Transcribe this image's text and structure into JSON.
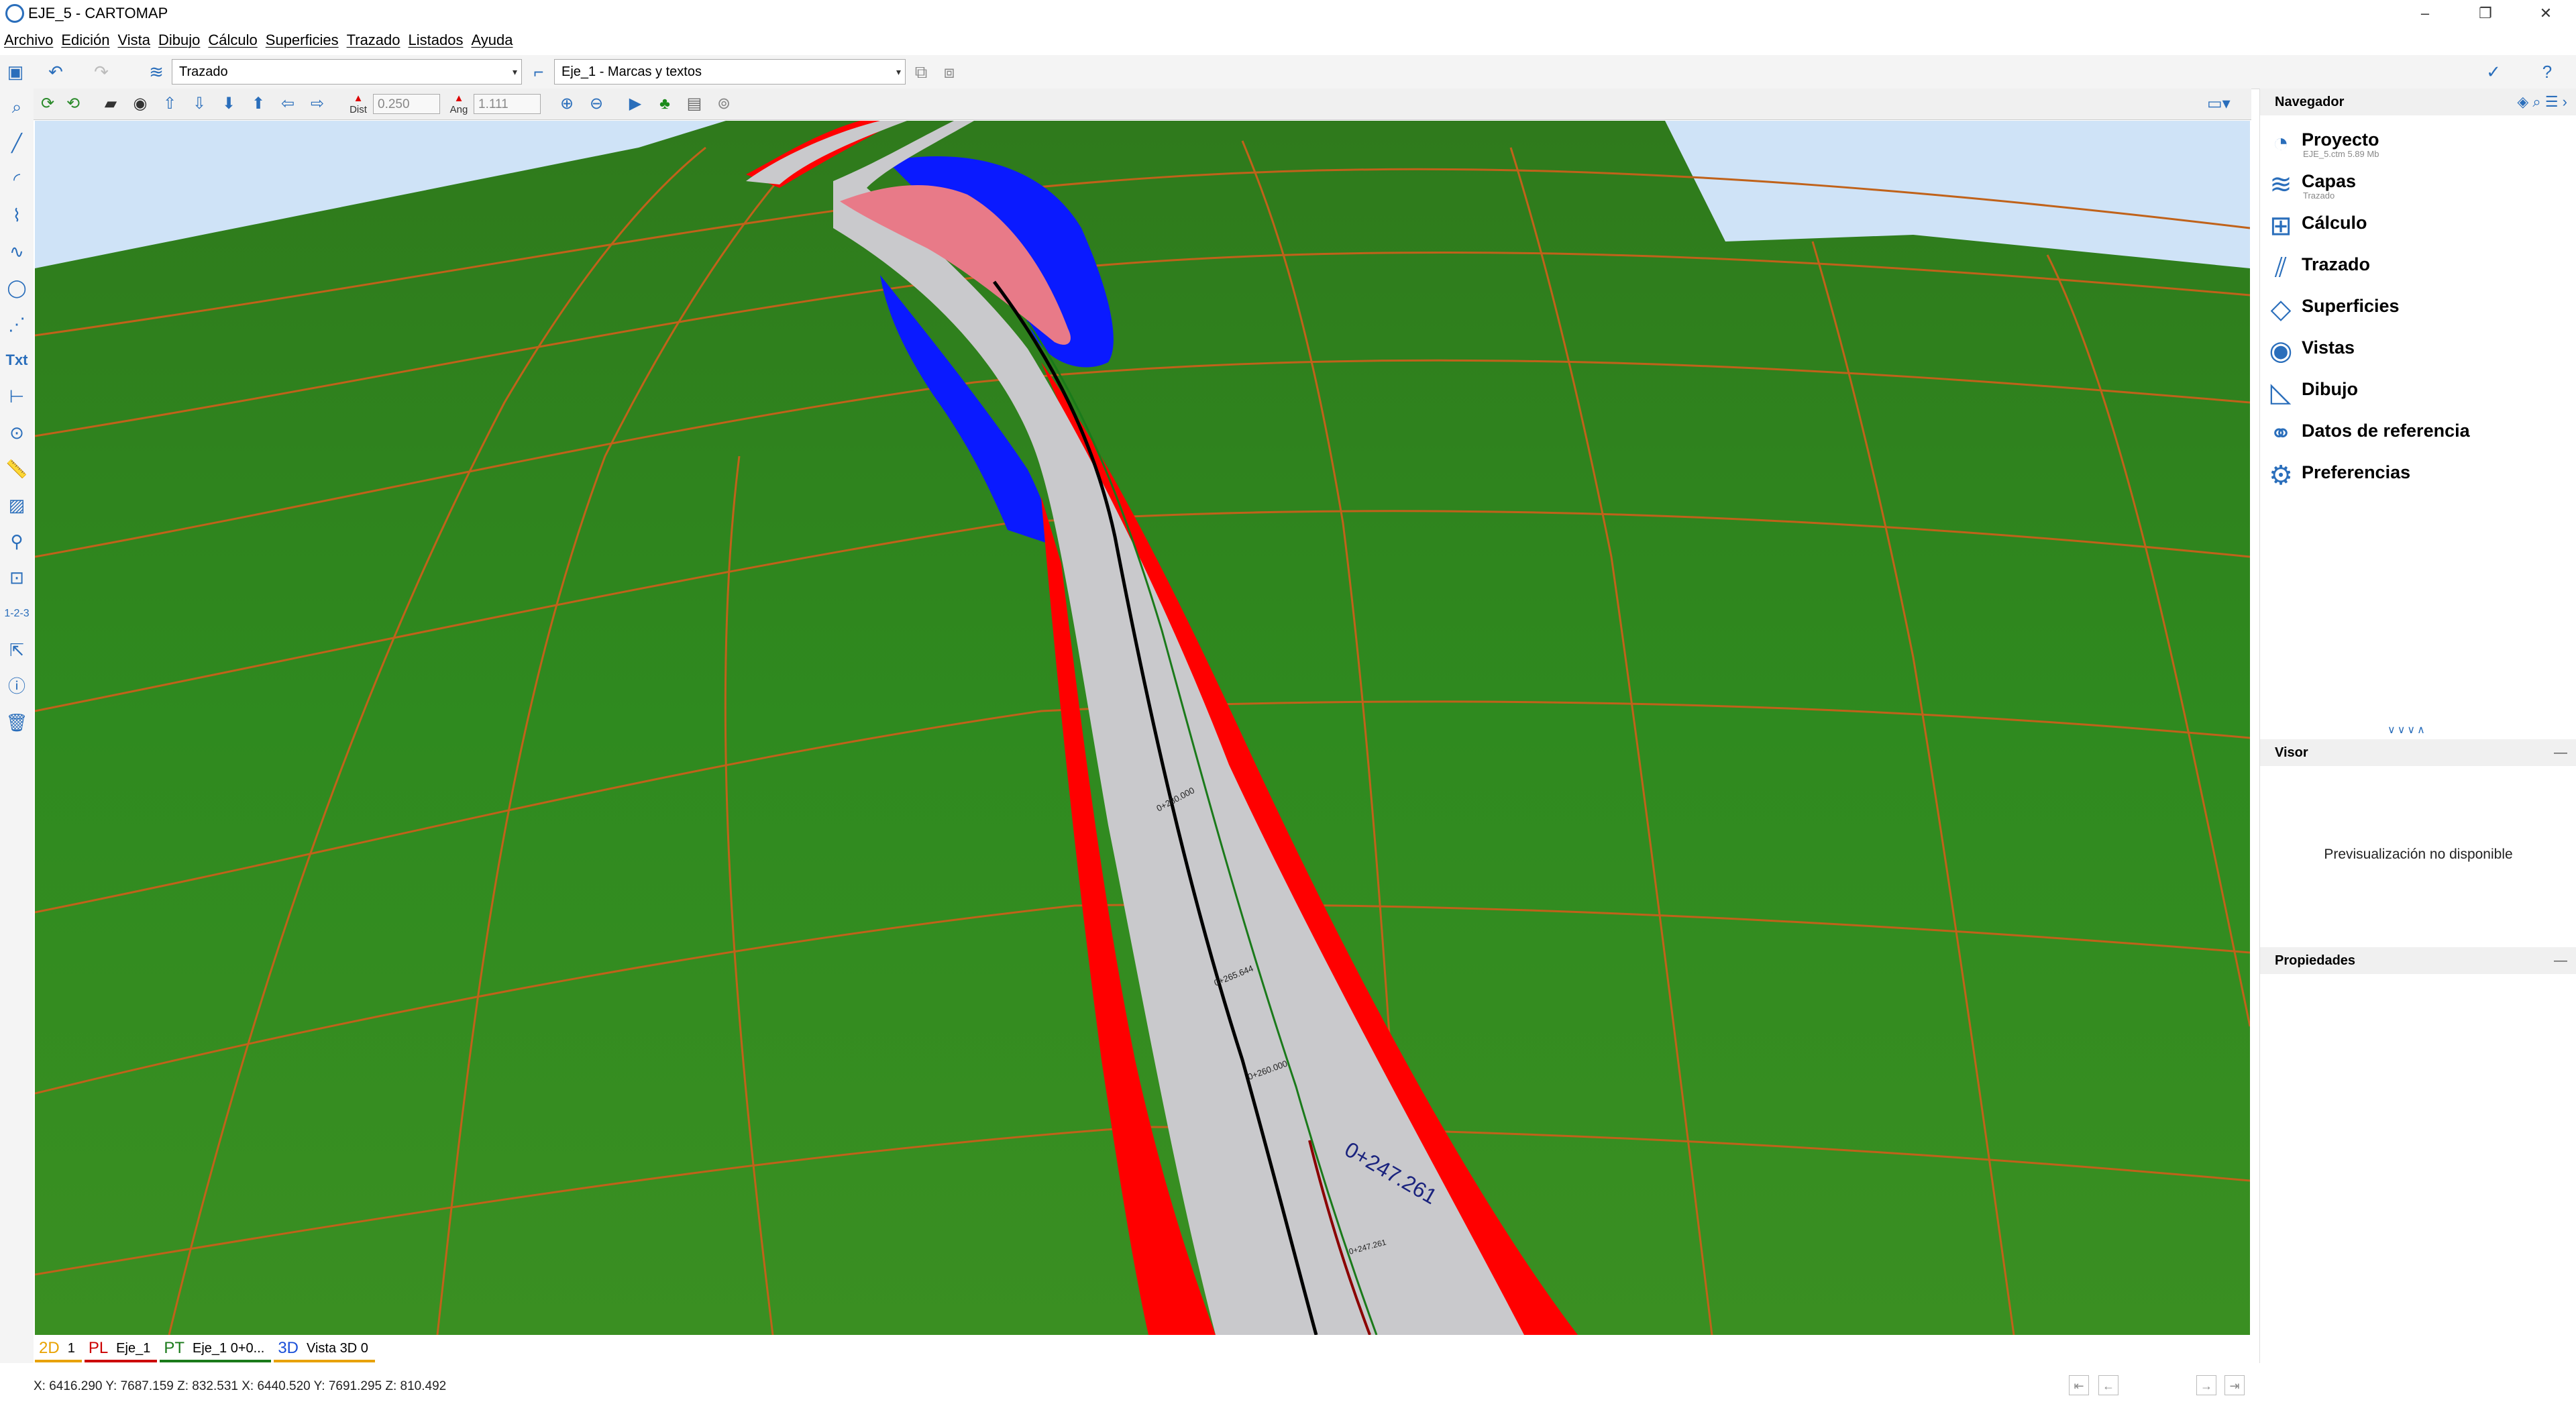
{
  "window": {
    "title": "EJE_5 - CARTOMAP",
    "controls": [
      "–",
      "❐",
      "✕"
    ]
  },
  "menu": [
    "Archivo",
    "Edición",
    "Vista",
    "Dibujo",
    "Cálculo",
    "Superficies",
    "Trazado",
    "Listados",
    "Ayuda"
  ],
  "toolbar": {
    "layer_combo": "Trazado",
    "object_combo": "Eje_1 - Marcas y textos"
  },
  "view_toolbar": {
    "dist_label": "Dist",
    "dist_value": "0.250",
    "ang_label": "Ang",
    "ang_value": "1.111"
  },
  "tabs": [
    {
      "prefix": "2D",
      "label": "1",
      "color": "#e8a200"
    },
    {
      "prefix": "PL",
      "label": "Eje_1",
      "color": "#cc0000"
    },
    {
      "prefix": "PT",
      "label": "Eje_1 0+0...",
      "color": "#1a7a1a"
    },
    {
      "prefix": "3D",
      "label": "Vista 3D 0",
      "color": "#1a4fd8",
      "active": true
    }
  ],
  "status": {
    "coords": "X: 6416.290  Y: 7687.159  Z: 832.531  X: 6440.520  Y: 7691.295  Z: 810.492"
  },
  "navigator": {
    "title": "Navegador",
    "items": [
      {
        "label": "Proyecto",
        "sub": "EJE_5.ctm 5.89 Mb",
        "icon": "project-icon"
      },
      {
        "label": "Capas",
        "sub": "Trazado",
        "icon": "layers-icon"
      },
      {
        "label": "Cálculo",
        "sub": "",
        "icon": "calculator-icon"
      },
      {
        "label": "Trazado",
        "sub": "",
        "icon": "alignment-icon"
      },
      {
        "label": "Superficies",
        "sub": "",
        "icon": "surface-icon"
      },
      {
        "label": "Vistas",
        "sub": "",
        "icon": "eye-icon"
      },
      {
        "label": "Dibujo",
        "sub": "",
        "icon": "drawing-icon"
      },
      {
        "label": "Datos de referencia",
        "sub": "",
        "icon": "link-icon"
      },
      {
        "label": "Preferencias",
        "sub": "",
        "icon": "gear-icon"
      }
    ]
  },
  "visor": {
    "title": "Visor",
    "message": "Previsualización no disponible"
  },
  "properties": {
    "title": "Propiedades"
  },
  "viewport": {
    "labels": [
      "0+280.000",
      "0+265.644",
      "0+260.000",
      "0+247.261",
      "0+247.261"
    ],
    "colors": {
      "sky": "#cfe3f7",
      "terrain": "#2e7d1a",
      "grid": "#c0621a",
      "road": "#c9c9cc",
      "cut": "#ff0000",
      "fill": "#0a1aff",
      "pink": "#e87a88"
    }
  }
}
